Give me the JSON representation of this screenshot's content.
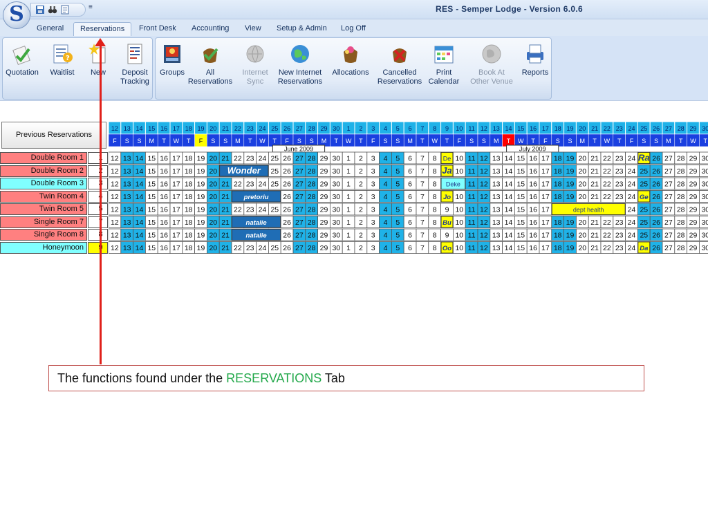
{
  "window": {
    "title": "RES - Semper Lodge - Version 6.0.6",
    "app_letter": "S",
    "qat_more": "≡"
  },
  "tabs": [
    "General",
    "Reservations",
    "Front Desk",
    "Accounting",
    "View",
    "Setup & Admin",
    "Log Off"
  ],
  "active_tab": "Reservations",
  "ribbon": {
    "groups": [
      {
        "buttons": [
          {
            "id": "quotation",
            "label": "Quotation",
            "icon": "quotation-icon",
            "enabled": true
          },
          {
            "id": "waitlist",
            "label": "Waitlist",
            "icon": "waitlist-icon",
            "enabled": true
          },
          {
            "id": "new",
            "label": "New",
            "icon": "new-reservation-icon",
            "enabled": true
          },
          {
            "id": "deposit-tracking",
            "label": "Deposit\nTracking",
            "icon": "deposit-tracking-icon",
            "enabled": true
          }
        ]
      },
      {
        "buttons": [
          {
            "id": "groups",
            "label": "Groups",
            "icon": "groups-icon",
            "enabled": true
          },
          {
            "id": "all-reservations",
            "label": "All\nReservations",
            "icon": "all-reservations-icon",
            "enabled": true
          },
          {
            "id": "internet-sync",
            "label": "Internet\nSync",
            "icon": "internet-sync-icon",
            "enabled": false
          },
          {
            "id": "new-internet-reservations",
            "label": "New Internet\nReservations",
            "icon": "globe-icon",
            "enabled": true
          },
          {
            "id": "allocations",
            "label": "Allocations",
            "icon": "allocations-icon",
            "enabled": true
          },
          {
            "id": "cancelled-reservations",
            "label": "Cancelled\nReservations",
            "icon": "cancelled-reservations-icon",
            "enabled": true
          },
          {
            "id": "print-calendar",
            "label": "Print\nCalendar",
            "icon": "print-calendar-icon",
            "enabled": true
          },
          {
            "id": "book-at-other-venue",
            "label": "Book At\nOther Venue",
            "icon": "book-other-venue-icon",
            "enabled": false
          },
          {
            "id": "reports",
            "label": "Reports",
            "icon": "reports-icon",
            "enabled": true
          }
        ]
      }
    ]
  },
  "calendar": {
    "previous_button": "Previous Reservations",
    "days": [
      12,
      13,
      14,
      15,
      16,
      17,
      18,
      19,
      20,
      21,
      22,
      23,
      24,
      25,
      26,
      27,
      28,
      29,
      30,
      1,
      2,
      3,
      4,
      5,
      6,
      7,
      8,
      9,
      10,
      11,
      12,
      13,
      14,
      15,
      16,
      17,
      18,
      19,
      20,
      21,
      22,
      23,
      24,
      25,
      26,
      27,
      28,
      29,
      30
    ],
    "weekdays": [
      "F",
      "S",
      "S",
      "M",
      "T",
      "W",
      "T",
      "F",
      "S",
      "S",
      "M",
      "T",
      "W",
      "T",
      "F",
      "S",
      "S",
      "M",
      "T",
      "W",
      "T",
      "F",
      "S",
      "S",
      "M",
      "T",
      "W",
      "T",
      "F",
      "S",
      "S",
      "M",
      "T",
      "W",
      "T",
      "F",
      "S",
      "S",
      "M",
      "T",
      "W",
      "T",
      "F",
      "S",
      "S",
      "M",
      "T",
      "W",
      "T"
    ],
    "month_labels": [
      {
        "text": "June 2009",
        "col": 13,
        "span": 4
      },
      {
        "text": "July 2009",
        "col": 32,
        "span": 4
      }
    ],
    "highlight_header": [
      {
        "col": 7,
        "color": "#ffff00"
      },
      {
        "col": 32,
        "color": "#ff0000"
      }
    ],
    "rooms": [
      {
        "name": "Double Room 1",
        "num": "1",
        "color": "#ff8080",
        "num_color": "#ffffff"
      },
      {
        "name": "Double Room 2",
        "num": "2",
        "color": "#ff8080",
        "num_color": "#ffffff"
      },
      {
        "name": "Double Room 3",
        "num": "3",
        "color": "#80ffff",
        "num_color": "#ffffff"
      },
      {
        "name": "Twin Room 4",
        "num": "4",
        "color": "#ff8080",
        "num_color": "#ffffff"
      },
      {
        "name": "Twin Room 5",
        "num": "5",
        "color": "#ff8080",
        "num_color": "#ffffff"
      },
      {
        "name": "Single Room 7",
        "num": "7",
        "color": "#ff8080",
        "num_color": "#ffffff"
      },
      {
        "name": "Single  Room 8",
        "num": "8",
        "color": "#ff8080",
        "num_color": "#ffffff"
      },
      {
        "name": "Honeymoon",
        "num": "9",
        "color": "#80ffff",
        "num_color": "#ffff00"
      }
    ],
    "bookings": [
      {
        "row": 0,
        "col": 27,
        "span": 1,
        "text": "De",
        "bg": "#ffff00",
        "fg": "#1f3a8a",
        "style": "small"
      },
      {
        "row": 0,
        "col": 43,
        "span": 1,
        "text": "Ra",
        "bg": "#ffff00",
        "fg": "#1f3a8a",
        "style": "bigitalic"
      },
      {
        "row": 1,
        "col": 9,
        "span": 4,
        "text": "Wonder",
        "bg": "#1f6db5",
        "fg": "#ffffff",
        "style": "bigitalic"
      },
      {
        "row": 1,
        "col": 27,
        "span": 1,
        "text": "Ja",
        "bg": "#ffff00",
        "fg": "#1f3a8a",
        "style": "bigitalic"
      },
      {
        "row": 2,
        "col": 27,
        "span": 2,
        "text": "Deke",
        "bg": "#80ffff",
        "fg": "#1f3a8a",
        "style": "small"
      },
      {
        "row": 3,
        "col": 27,
        "span": 1,
        "text": "Jo",
        "bg": "#ffff00",
        "fg": "#1f3a8a",
        "style": "italic"
      },
      {
        "row": 3,
        "col": 43,
        "span": 1,
        "text": "Ge",
        "bg": "#ffff00",
        "fg": "#1f3a8a",
        "style": "italic"
      },
      {
        "row": 4,
        "col": 36,
        "span": 6,
        "text": "dept health",
        "bg": "#ffff00",
        "fg": "#1f3a8a",
        "style": "small"
      },
      {
        "row": 5,
        "col": 10,
        "span": 4,
        "text": "natalie",
        "bg": "#1f6db5",
        "fg": "#ffffff",
        "style": "italic"
      },
      {
        "row": 5,
        "col": 27,
        "span": 1,
        "text": "Bu",
        "bg": "#ffff00",
        "fg": "#1f3a8a",
        "style": "italic"
      },
      {
        "row": 6,
        "col": 10,
        "span": 4,
        "text": "natalie",
        "bg": "#1f6db5",
        "fg": "#ffffff",
        "style": "italic"
      },
      {
        "row": 3,
        "col": 10,
        "span": 4,
        "text": "pretoriu",
        "bg": "#1f6db5",
        "fg": "#ffffff",
        "style": "italic"
      },
      {
        "row": 7,
        "col": 27,
        "span": 1,
        "text": "Oo",
        "bg": "#ffff00",
        "fg": "#1f3a8a",
        "style": "italic"
      },
      {
        "row": 7,
        "col": 43,
        "span": 1,
        "text": "Da",
        "bg": "#ffff00",
        "fg": "#1f3a8a",
        "style": "italic"
      }
    ],
    "colors": {
      "weekend": "#1fb2e8",
      "header_day_bg": "#1fb2e8",
      "header_weekday_bg": "#1a3fe0",
      "cell_bg": "#ffffff"
    }
  },
  "caption": {
    "prefix": "The functions found under the ",
    "highlight": "RESERVATIONS",
    "suffix": " Tab"
  }
}
